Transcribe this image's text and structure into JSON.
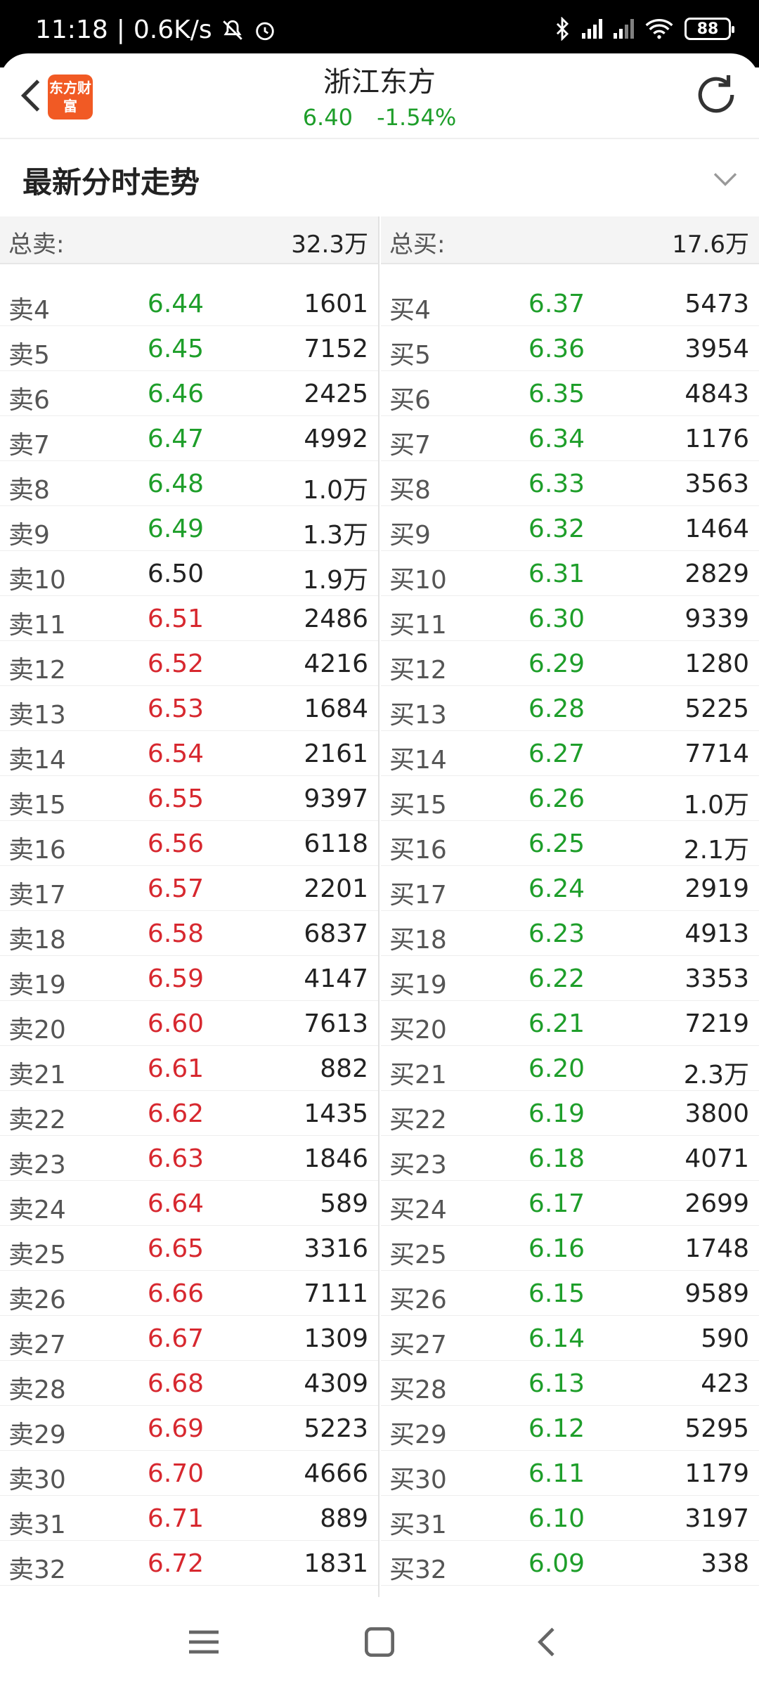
{
  "status": {
    "time": "11:18",
    "speed": "0.6K/s",
    "battery": "88"
  },
  "header": {
    "logo_text": "东方财富",
    "title": "浙江东方",
    "price": "6.40",
    "change": "-1.54%"
  },
  "section": {
    "title": "最新分时走势"
  },
  "totals": {
    "sell_label": "总卖:",
    "sell_value": "32.3万",
    "buy_label": "总买:",
    "buy_value": "17.6万"
  },
  "sell_rows": [
    {
      "level": "卖4",
      "price": "6.44",
      "vol": "1601",
      "color": "green"
    },
    {
      "level": "卖5",
      "price": "6.45",
      "vol": "7152",
      "color": "green"
    },
    {
      "level": "卖6",
      "price": "6.46",
      "vol": "2425",
      "color": "green"
    },
    {
      "level": "卖7",
      "price": "6.47",
      "vol": "4992",
      "color": "green"
    },
    {
      "level": "卖8",
      "price": "6.48",
      "vol": "1.0万",
      "color": "green"
    },
    {
      "level": "卖9",
      "price": "6.49",
      "vol": "1.3万",
      "color": "green"
    },
    {
      "level": "卖10",
      "price": "6.50",
      "vol": "1.9万",
      "color": "neutral"
    },
    {
      "level": "卖11",
      "price": "6.51",
      "vol": "2486",
      "color": "red"
    },
    {
      "level": "卖12",
      "price": "6.52",
      "vol": "4216",
      "color": "red"
    },
    {
      "level": "卖13",
      "price": "6.53",
      "vol": "1684",
      "color": "red"
    },
    {
      "level": "卖14",
      "price": "6.54",
      "vol": "2161",
      "color": "red"
    },
    {
      "level": "卖15",
      "price": "6.55",
      "vol": "9397",
      "color": "red"
    },
    {
      "level": "卖16",
      "price": "6.56",
      "vol": "6118",
      "color": "red"
    },
    {
      "level": "卖17",
      "price": "6.57",
      "vol": "2201",
      "color": "red"
    },
    {
      "level": "卖18",
      "price": "6.58",
      "vol": "6837",
      "color": "red"
    },
    {
      "level": "卖19",
      "price": "6.59",
      "vol": "4147",
      "color": "red"
    },
    {
      "level": "卖20",
      "price": "6.60",
      "vol": "7613",
      "color": "red"
    },
    {
      "level": "卖21",
      "price": "6.61",
      "vol": "882",
      "color": "red"
    },
    {
      "level": "卖22",
      "price": "6.62",
      "vol": "1435",
      "color": "red"
    },
    {
      "level": "卖23",
      "price": "6.63",
      "vol": "1846",
      "color": "red"
    },
    {
      "level": "卖24",
      "price": "6.64",
      "vol": "589",
      "color": "red"
    },
    {
      "level": "卖25",
      "price": "6.65",
      "vol": "3316",
      "color": "red"
    },
    {
      "level": "卖26",
      "price": "6.66",
      "vol": "7111",
      "color": "red"
    },
    {
      "level": "卖27",
      "price": "6.67",
      "vol": "1309",
      "color": "red"
    },
    {
      "level": "卖28",
      "price": "6.68",
      "vol": "4309",
      "color": "red"
    },
    {
      "level": "卖29",
      "price": "6.69",
      "vol": "5223",
      "color": "red"
    },
    {
      "level": "卖30",
      "price": "6.70",
      "vol": "4666",
      "color": "red"
    },
    {
      "level": "卖31",
      "price": "6.71",
      "vol": "889",
      "color": "red"
    },
    {
      "level": "卖32",
      "price": "6.72",
      "vol": "1831",
      "color": "red"
    }
  ],
  "buy_rows": [
    {
      "level": "买4",
      "price": "6.37",
      "vol": "5473",
      "color": "green"
    },
    {
      "level": "买5",
      "price": "6.36",
      "vol": "3954",
      "color": "green"
    },
    {
      "level": "买6",
      "price": "6.35",
      "vol": "4843",
      "color": "green"
    },
    {
      "level": "买7",
      "price": "6.34",
      "vol": "1176",
      "color": "green"
    },
    {
      "level": "买8",
      "price": "6.33",
      "vol": "3563",
      "color": "green"
    },
    {
      "level": "买9",
      "price": "6.32",
      "vol": "1464",
      "color": "green"
    },
    {
      "level": "买10",
      "price": "6.31",
      "vol": "2829",
      "color": "green"
    },
    {
      "level": "买11",
      "price": "6.30",
      "vol": "9339",
      "color": "green"
    },
    {
      "level": "买12",
      "price": "6.29",
      "vol": "1280",
      "color": "green"
    },
    {
      "level": "买13",
      "price": "6.28",
      "vol": "5225",
      "color": "green"
    },
    {
      "level": "买14",
      "price": "6.27",
      "vol": "7714",
      "color": "green"
    },
    {
      "level": "买15",
      "price": "6.26",
      "vol": "1.0万",
      "color": "green"
    },
    {
      "level": "买16",
      "price": "6.25",
      "vol": "2.1万",
      "color": "green"
    },
    {
      "level": "买17",
      "price": "6.24",
      "vol": "2919",
      "color": "green"
    },
    {
      "level": "买18",
      "price": "6.23",
      "vol": "4913",
      "color": "green"
    },
    {
      "level": "买19",
      "price": "6.22",
      "vol": "3353",
      "color": "green"
    },
    {
      "level": "买20",
      "price": "6.21",
      "vol": "7219",
      "color": "green"
    },
    {
      "level": "买21",
      "price": "6.20",
      "vol": "2.3万",
      "color": "green"
    },
    {
      "level": "买22",
      "price": "6.19",
      "vol": "3800",
      "color": "green"
    },
    {
      "level": "买23",
      "price": "6.18",
      "vol": "4071",
      "color": "green"
    },
    {
      "level": "买24",
      "price": "6.17",
      "vol": "2699",
      "color": "green"
    },
    {
      "level": "买25",
      "price": "6.16",
      "vol": "1748",
      "color": "green"
    },
    {
      "level": "买26",
      "price": "6.15",
      "vol": "9589",
      "color": "green"
    },
    {
      "level": "买27",
      "price": "6.14",
      "vol": "590",
      "color": "green"
    },
    {
      "level": "买28",
      "price": "6.13",
      "vol": "423",
      "color": "green"
    },
    {
      "level": "买29",
      "price": "6.12",
      "vol": "5295",
      "color": "green"
    },
    {
      "level": "买30",
      "price": "6.11",
      "vol": "1179",
      "color": "green"
    },
    {
      "level": "买31",
      "price": "6.10",
      "vol": "3197",
      "color": "green"
    },
    {
      "level": "买32",
      "price": "6.09",
      "vol": "338",
      "color": "green"
    }
  ],
  "icons": {
    "back": "back-arrow-icon",
    "refresh": "refresh-icon",
    "collapse": "chevron-down-icon",
    "menu": "menu-icon",
    "home": "home-icon",
    "nav_back": "nav-back-icon"
  }
}
